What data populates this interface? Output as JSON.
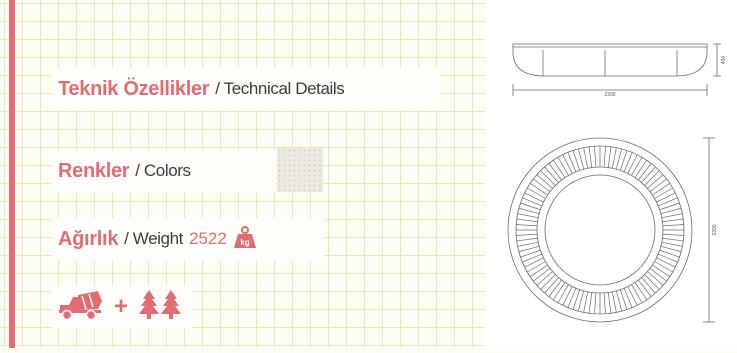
{
  "labels": {
    "technical_tr": "Teknik Özellikler",
    "technical_en": "/ Technical Details",
    "colors_tr": "Renkler",
    "colors_en": "/ Colors",
    "weight_tr": "Ağırlık",
    "weight_en": "/ Weight",
    "weight_value": "2522",
    "weight_unit": "kg"
  },
  "drawing": {
    "elevation_width": "2200",
    "elevation_height": "450",
    "plan_diameter": "2200"
  },
  "icons": [
    "concrete-mixer-truck-icon",
    "plus-icon",
    "two-trees-icon"
  ],
  "colors": {
    "accent": "#e36c72",
    "grid": "#e3ebb6",
    "swatch": "#ebe9e2"
  }
}
